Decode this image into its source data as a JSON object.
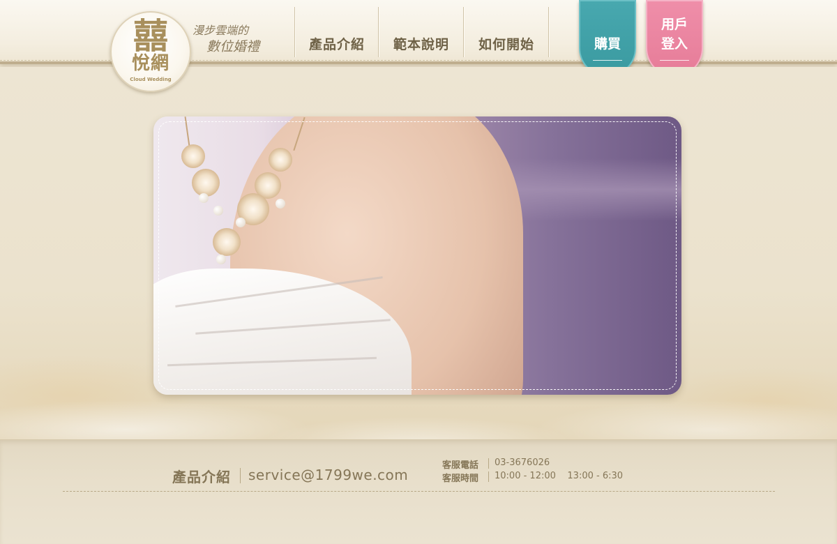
{
  "logo": {
    "mark": "囍",
    "name": "悅網",
    "subtitle_en": "Cloud Wedding"
  },
  "slogan": {
    "line1": "漫步雲端的",
    "line2": "數位婚禮"
  },
  "nav": {
    "items": [
      {
        "label": "產品介紹"
      },
      {
        "label": "範本說明"
      },
      {
        "label": "如何開始"
      }
    ]
  },
  "tabs": {
    "buy": "購買",
    "login_line1": "用戶",
    "login_line2": "登入"
  },
  "footer": {
    "product_link": "產品介紹",
    "email": "service@1799we.com",
    "phone_label": "客服電話",
    "phone": "03-3676026",
    "hours_label": "客服時間",
    "hours": "10:00 - 12:00    13:00 - 6:30"
  },
  "colors": {
    "buy_tab": "#3a9aa0",
    "login_tab": "#e67c98",
    "text_brown": "#6f6247"
  }
}
